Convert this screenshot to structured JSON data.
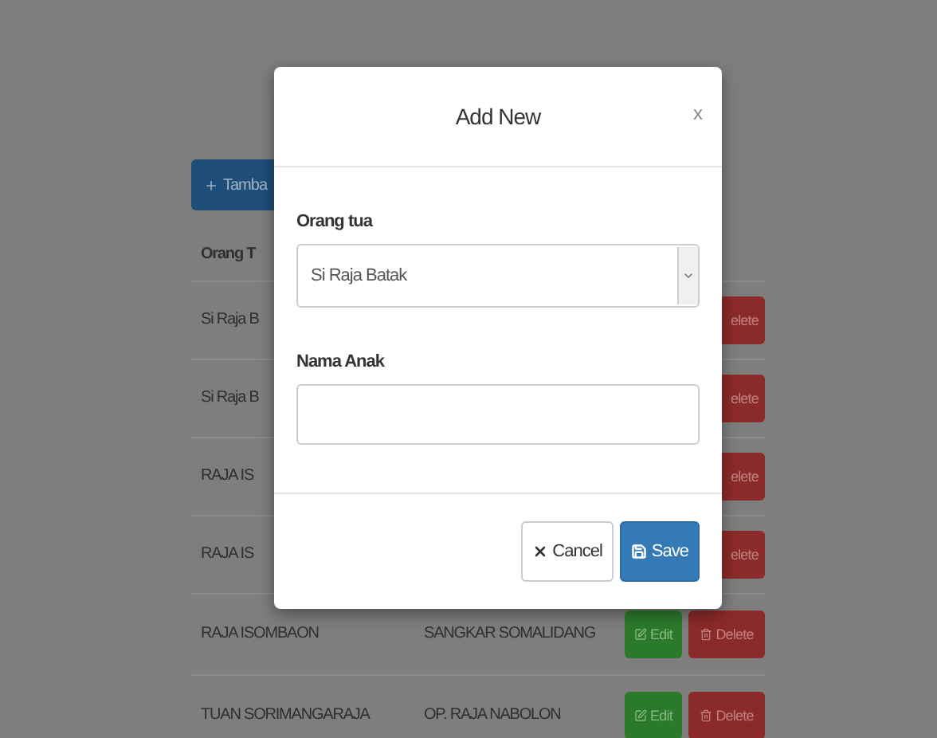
{
  "add_button": {
    "label": "Tamba"
  },
  "table": {
    "columns": [
      "Orang T"
    ],
    "rows": [
      {
        "cells": [
          "Si Raja B"
        ],
        "actions": [
          {
            "kind": "delete",
            "label": "elete"
          }
        ]
      },
      {
        "cells": [
          "Si Raja B"
        ],
        "actions": [
          {
            "kind": "delete",
            "label": "elete"
          }
        ]
      },
      {
        "cells": [
          "RAJA IS"
        ],
        "actions": [
          {
            "kind": "delete",
            "label": "elete"
          }
        ]
      },
      {
        "cells": [
          "RAJA IS"
        ],
        "actions": [
          {
            "kind": "delete",
            "label": "elete"
          }
        ]
      },
      {
        "cells": [
          "RAJA ISOMBAON",
          "SANGKAR SOMALIDANG"
        ],
        "actions": [
          {
            "kind": "edit",
            "label": "Edit"
          },
          {
            "kind": "delete",
            "label": "Delete"
          }
        ]
      },
      {
        "cells": [
          "TUAN SORIMANGARAJA",
          "OP. RAJA NABOLON"
        ],
        "actions": [
          {
            "kind": "edit",
            "label": "Edit"
          },
          {
            "kind": "delete",
            "label": "Delete"
          }
        ]
      }
    ]
  },
  "modal": {
    "title": "Add New",
    "close": "x",
    "fields": [
      {
        "kind": "select",
        "label": "Orang tua",
        "value": "Si Raja Batak"
      },
      {
        "kind": "text",
        "label": "Nama Anak"
      }
    ],
    "buttons": [
      {
        "kind": "cancel",
        "label": "Cancel"
      },
      {
        "kind": "save",
        "label": "Save"
      }
    ]
  }
}
